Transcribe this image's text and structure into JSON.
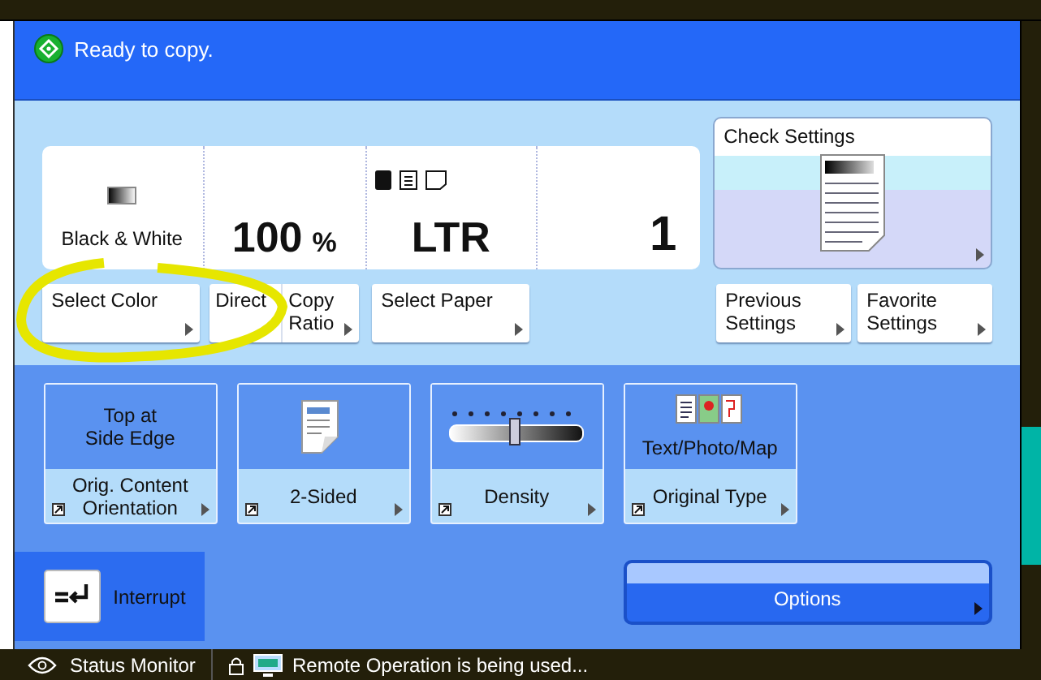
{
  "status_message": "Ready to copy.",
  "summary": {
    "color_mode": "Black & White",
    "ratio": "100",
    "ratio_unit": "%",
    "paper": "LTR",
    "copies": "1"
  },
  "check_settings": {
    "label": "Check Settings"
  },
  "setting_buttons": [
    {
      "kind": "single",
      "label": "Select Color"
    },
    {
      "kind": "split",
      "prefix": "Direct",
      "label": "Copy Ratio"
    },
    {
      "kind": "single",
      "label": "Select Paper"
    }
  ],
  "shortcut_buttons": [
    {
      "label": "Previous Settings"
    },
    {
      "label": "Favorite Settings"
    }
  ],
  "function_tiles": [
    {
      "kind": "text",
      "value": "Top at Side Edge",
      "label": "Orig. Content Orientation"
    },
    {
      "kind": "duplex",
      "label": "2-Sided"
    },
    {
      "kind": "density",
      "label": "Density"
    },
    {
      "kind": "type",
      "value": "Text/Photo/Map",
      "label": "Original Type"
    }
  ],
  "interrupt": {
    "label": "Interrupt"
  },
  "options": {
    "label": "Options"
  },
  "status_bar": {
    "monitor": "Status Monitor",
    "message": "Remote Operation is being used..."
  }
}
